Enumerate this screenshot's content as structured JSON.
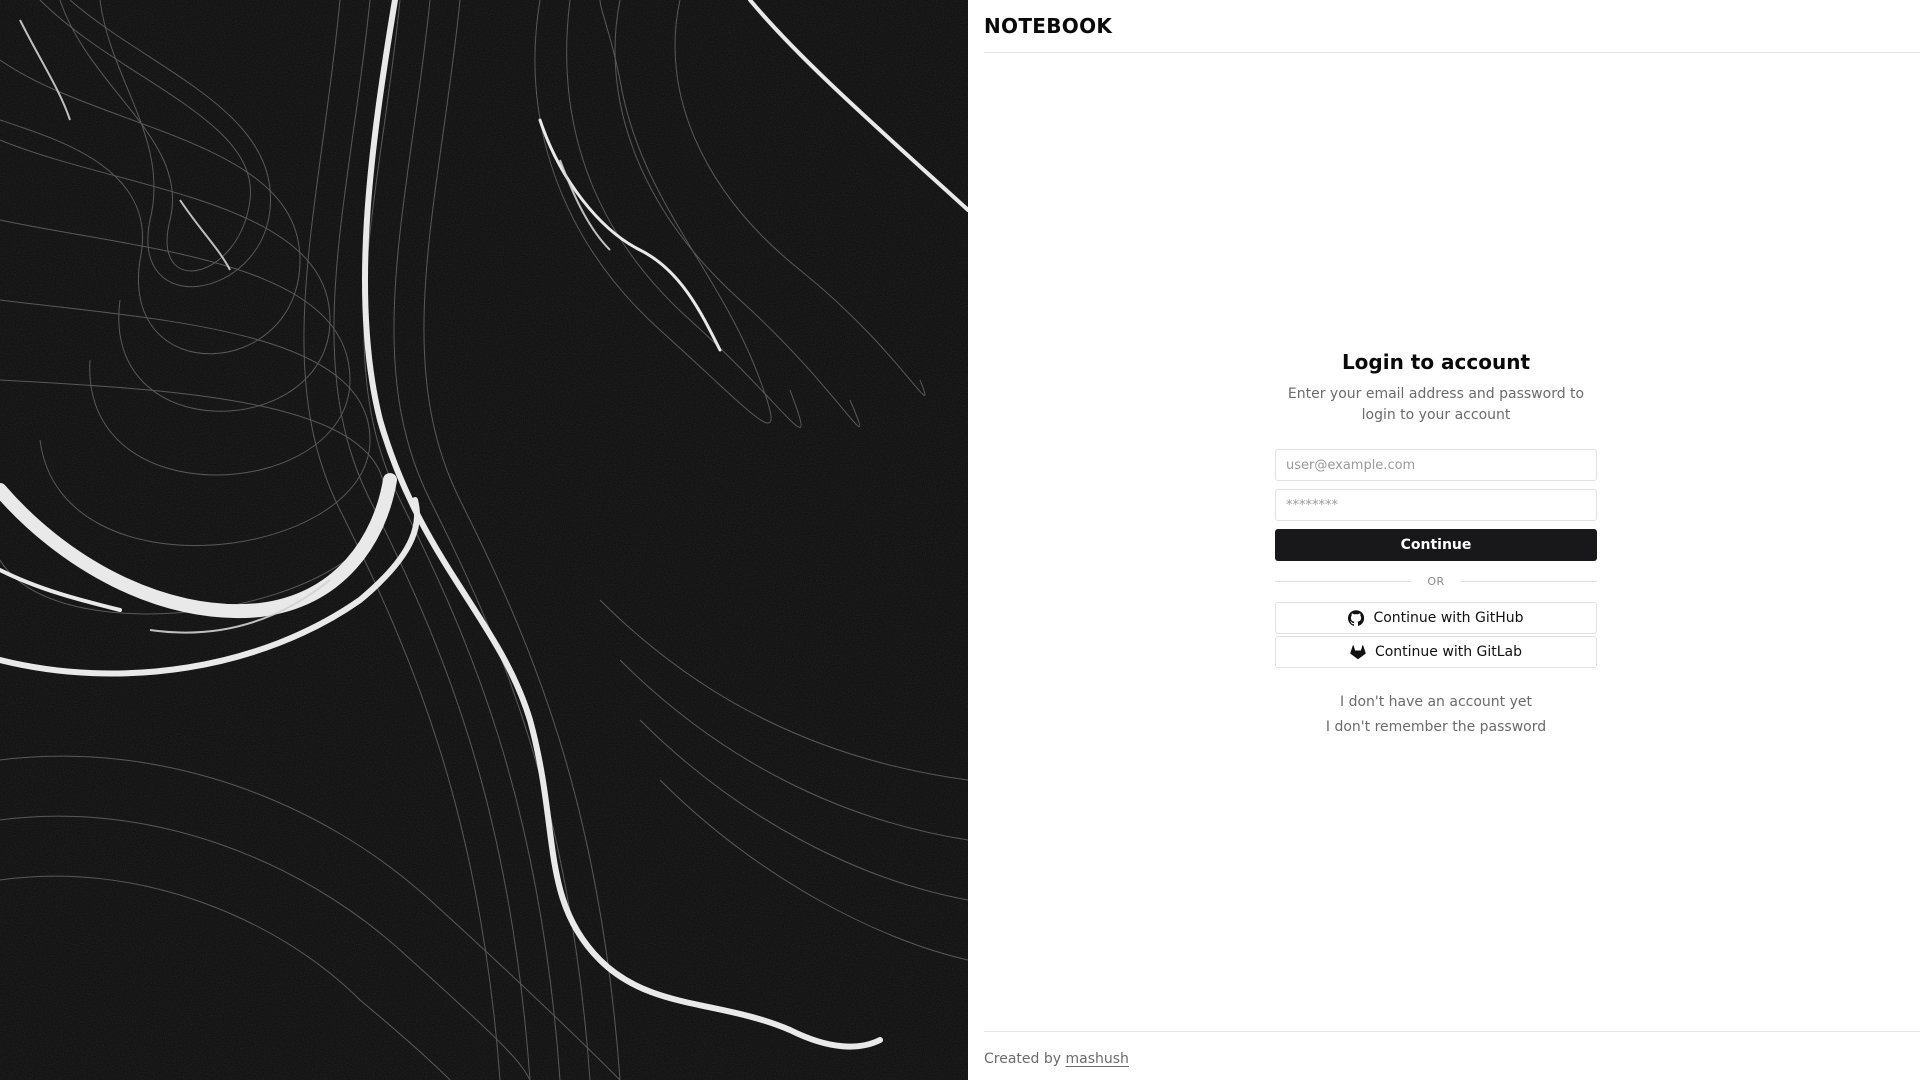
{
  "header": {
    "brand": "NOTEBOOK"
  },
  "login": {
    "title": "Login to account",
    "subtitle": "Enter your email address and password to login to your account",
    "email_placeholder": "user@example.com",
    "password_placeholder": "********",
    "continue_label": "Continue",
    "divider_label": "OR",
    "github_label": "Continue with GitHub",
    "gitlab_label": "Continue with GitLab",
    "github_icon": "github-icon",
    "gitlab_icon": "gitlab-icon"
  },
  "links": {
    "no_account": "I don't have an account yet",
    "forgot_password": "I don't remember the password"
  },
  "footer": {
    "created_by": "Created by",
    "author": "mashush"
  },
  "colors": {
    "primary_button": "#18181b",
    "muted_text": "#6b6b6b",
    "border": "#e2e2e2",
    "art_background": "#0b0b0b"
  }
}
